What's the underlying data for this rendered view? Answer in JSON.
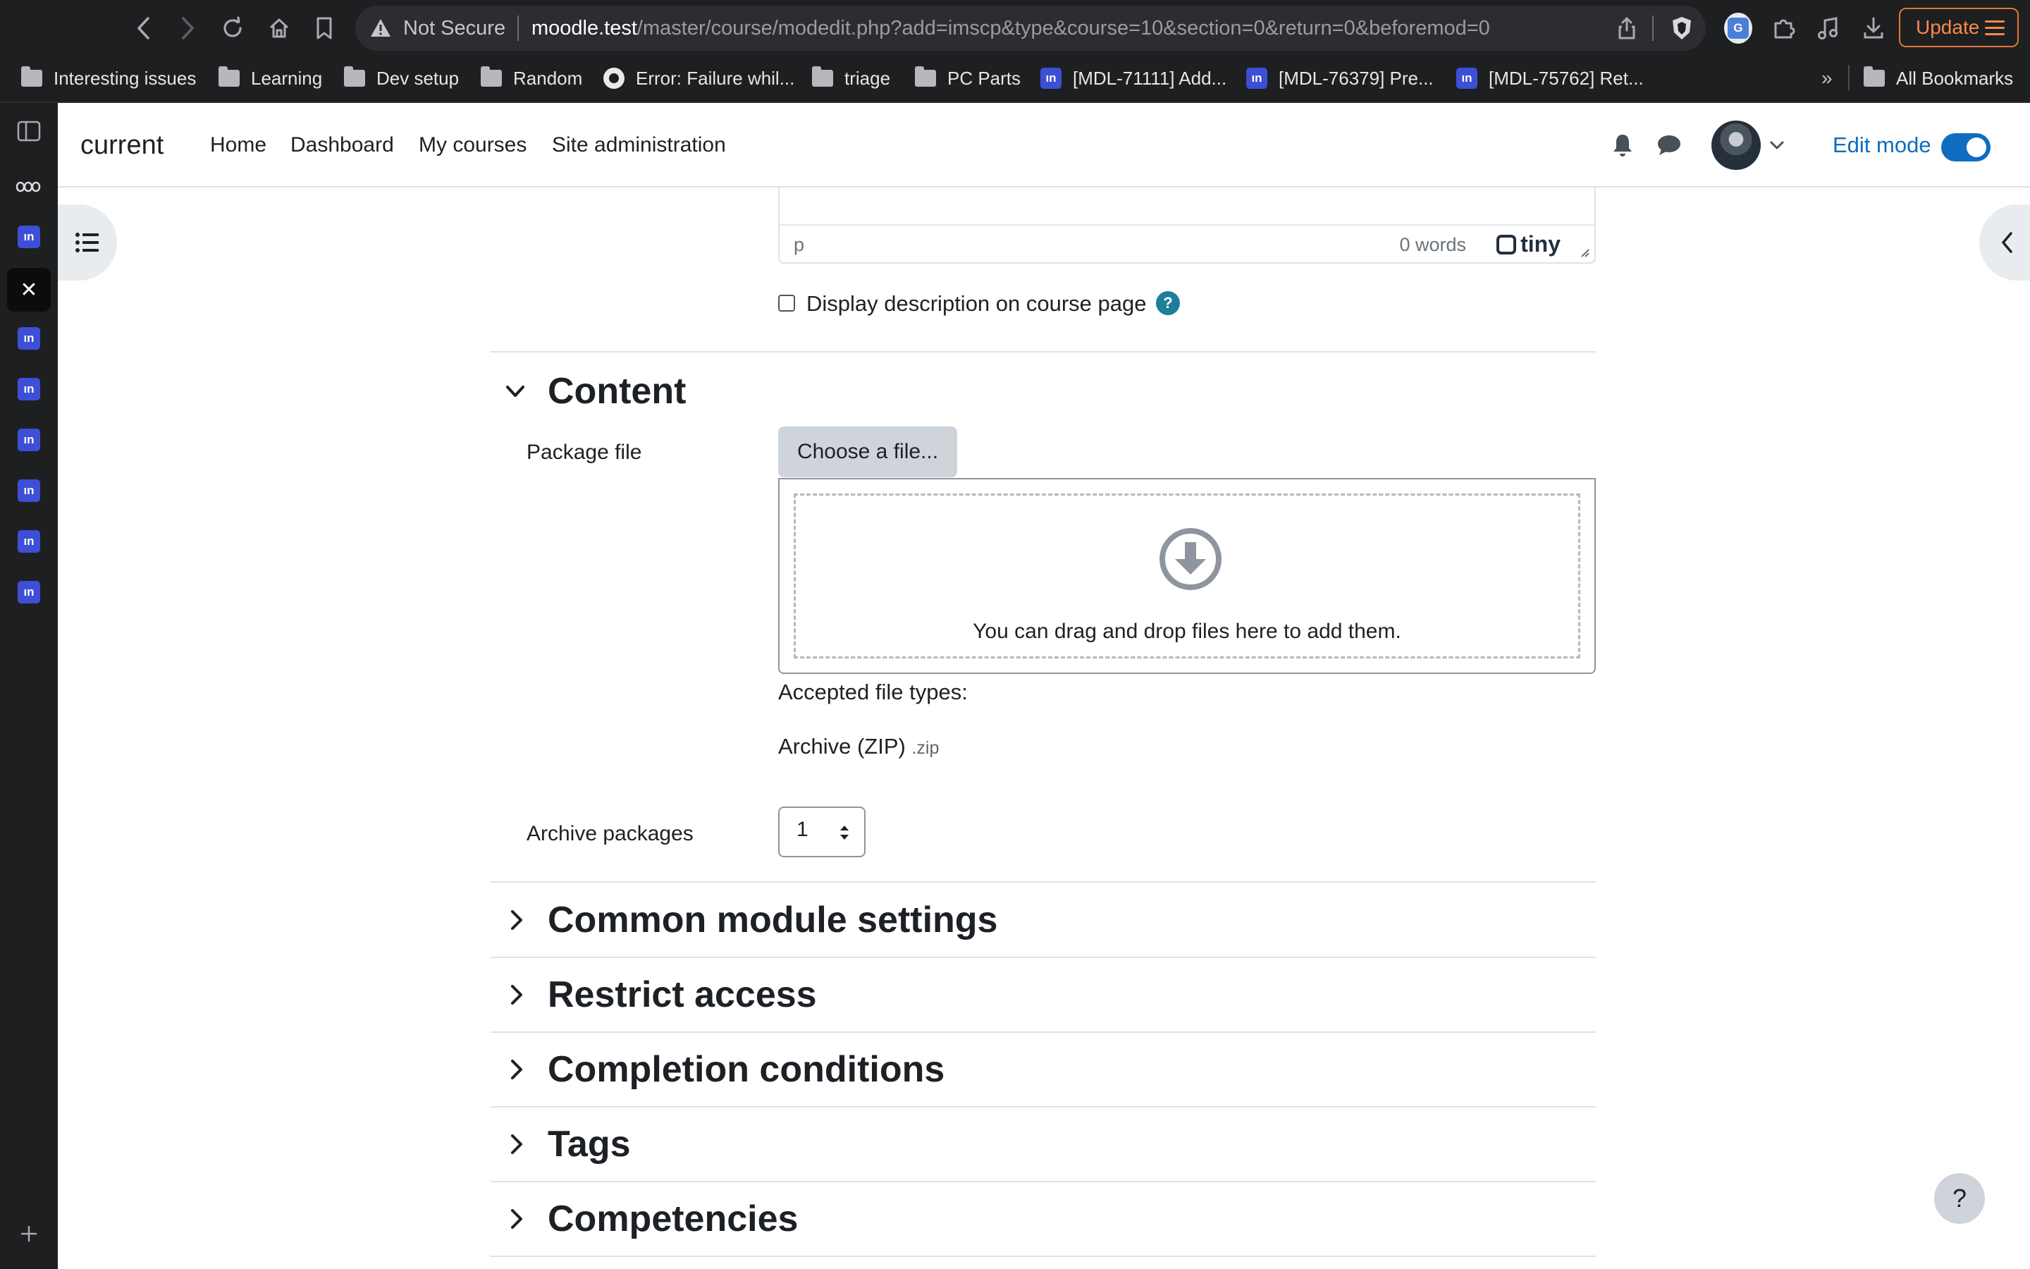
{
  "browser": {
    "url_warning": "Not Secure",
    "url_host": "moodle.test",
    "url_path": "/master/course/modedit.php?add=imscp&type&course=10&section=0&return=0&beforemod=0",
    "update_label": "Update",
    "accent_color": "#f58a4b"
  },
  "bookmarks": [
    {
      "icon": "folder-icon",
      "label": "Interesting issues"
    },
    {
      "icon": "folder-icon",
      "label": "Learning"
    },
    {
      "icon": "folder-icon",
      "label": "Dev setup"
    },
    {
      "icon": "folder-icon",
      "label": "Random"
    },
    {
      "icon": "github-icon",
      "label": "Error: Failure whil..."
    },
    {
      "icon": "folder-icon",
      "label": "triage"
    },
    {
      "icon": "folder-icon",
      "label": "PC Parts"
    },
    {
      "icon": "moodle-icon",
      "label": "[MDL-71111] Add..."
    },
    {
      "icon": "moodle-icon",
      "label": "[MDL-76379] Pre..."
    },
    {
      "icon": "moodle-icon",
      "label": "[MDL-75762] Ret..."
    }
  ],
  "bookmarks_overflow": "»",
  "all_bookmarks": "All Bookmarks",
  "moodle_icon_text": "ın",
  "moodle": {
    "site_name": "current",
    "nav": [
      "Home",
      "Dashboard",
      "My courses",
      "Site administration"
    ],
    "edit_mode_label": "Edit mode",
    "edit_mode_on": true,
    "primary_color": "#0f6cbf"
  },
  "editor": {
    "path": "p",
    "word_count": "0 words",
    "brand": "tiny"
  },
  "description": {
    "checkbox_label": "Display description on course page",
    "checked": false,
    "help": "?"
  },
  "content_section": {
    "title": "Content",
    "package_label": "Package file",
    "choose_button": "Choose a file...",
    "dropzone_text": "You can drag and drop files here to add them.",
    "accepted_label": "Accepted file types:",
    "accepted_type": "Archive (ZIP)",
    "accepted_ext": ".zip",
    "archive_label": "Archive packages",
    "archive_value": "1"
  },
  "collapsed_sections": [
    "Common module settings",
    "Restrict access",
    "Completion conditions",
    "Tags",
    "Competencies"
  ],
  "help_button": "?"
}
